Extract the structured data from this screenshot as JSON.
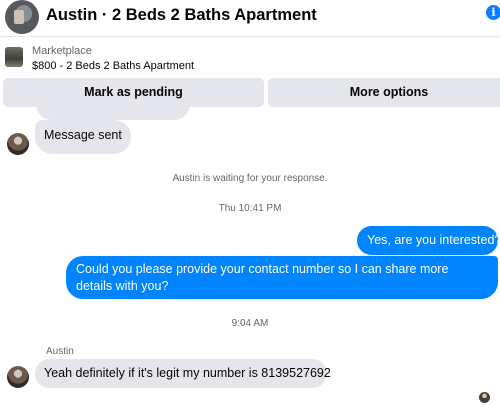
{
  "header": {
    "title": "Austin · 2 Beds 2 Baths Apartment",
    "info_glyph": "i",
    "info_color": "#0a7cff"
  },
  "marketplace": {
    "label": "Marketplace",
    "listing": "$800 - 2 Beds 2 Baths Apartment"
  },
  "actions": {
    "pending_label": "Mark as pending",
    "more_label": "More options"
  },
  "messages": {
    "received_1": "Message sent",
    "waiting_notice": "Austin is waiting for your response.",
    "timestamp_1": "Thu 10:41 PM",
    "sent_1": "Yes, are you interested?",
    "sent_2": "Could you please provide your contact number so I can share more details with you?",
    "timestamp_2": "9:04 AM",
    "sender_name": "Austin",
    "received_2": "Yeah definitely if it's legit my number is 8139527692"
  },
  "colors": {
    "outgoing_bubble": "#0084ff",
    "incoming_bubble": "#e4e6eb",
    "secondary_text": "#65676b"
  }
}
